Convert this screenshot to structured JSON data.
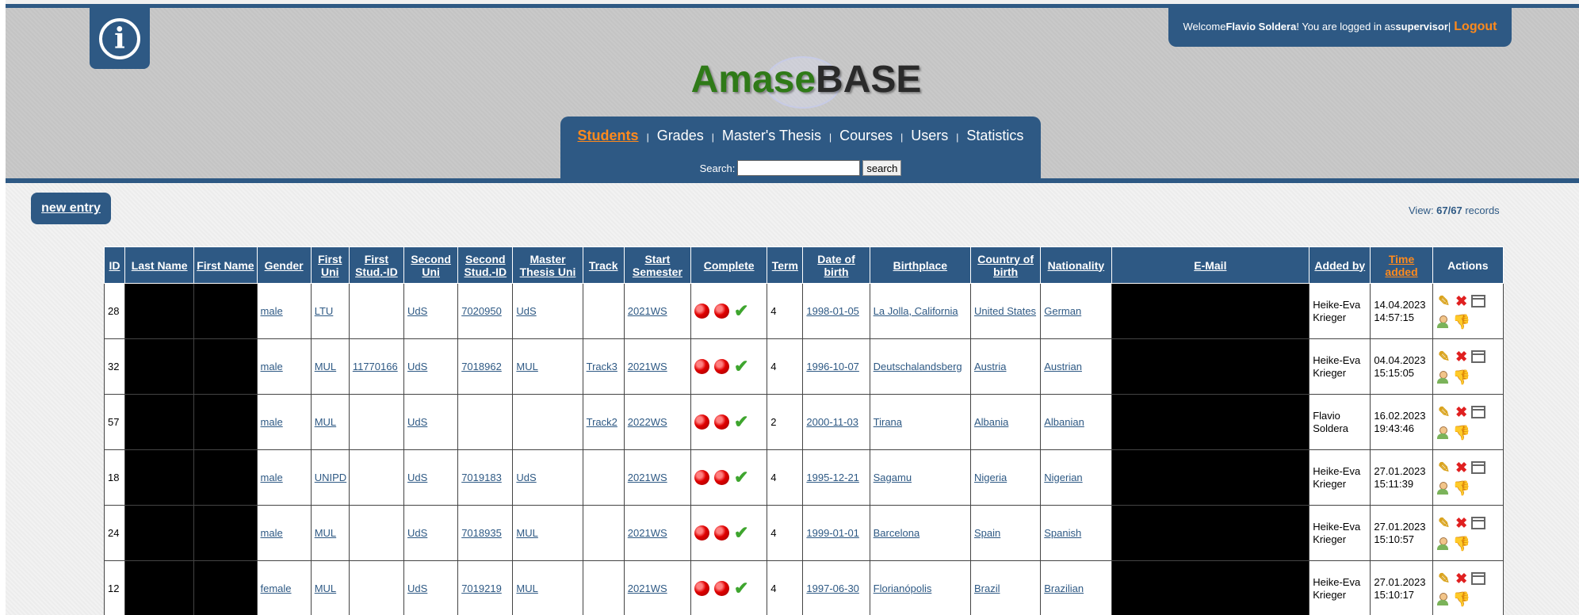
{
  "header": {
    "info_icon": "info-icon",
    "logo": {
      "part1": "Amase",
      "part2": "BASE"
    },
    "welcome": {
      "prefix": "Welcome ",
      "user_name": "Flavio Soldera",
      "middle": "! You are logged in as ",
      "role": "supervisor",
      "separator": " | ",
      "logout_label": "Logout"
    }
  },
  "nav": {
    "items": [
      {
        "label": "Students",
        "active": true
      },
      {
        "label": "Grades",
        "active": false
      },
      {
        "label": "Master's Thesis",
        "active": false
      },
      {
        "label": "Courses",
        "active": false
      },
      {
        "label": "Users",
        "active": false
      },
      {
        "label": "Statistics",
        "active": false
      }
    ],
    "separator": "|",
    "search_label": "Search:",
    "search_value": "",
    "search_button": "search"
  },
  "toolbar": {
    "new_entry_label": "new entry",
    "view_prefix": "View: ",
    "view_count": "67/67",
    "view_suffix": " records"
  },
  "colors": {
    "accent": "#2e5984",
    "active": "#ff8a1c",
    "status_red": "#e00000",
    "status_green": "#3ea52e"
  },
  "table": {
    "headers": [
      "ID",
      "Last Name",
      "First Name",
      "Gender",
      "First Uni",
      "First Stud.-ID",
      "Second Uni",
      "Second Stud.-ID",
      "Master Thesis Uni",
      "Track",
      "Start Semester",
      "Complete",
      "Term",
      "Date of birth",
      "Birthplace",
      "Country of birth",
      "Nationality",
      "E-Mail",
      "Added by",
      "Time added",
      "Actions"
    ],
    "rows": [
      {
        "id": "28",
        "gender": "male",
        "first_uni": "LTU",
        "first_stud_id": "",
        "second_uni": "UdS",
        "second_stud_id": "7020950",
        "thesis_uni": "UdS",
        "track": "",
        "start_semester": "2021WS",
        "term": "4",
        "dob": "1998-01-05",
        "birthplace": "La Jolla, California",
        "country": "United States",
        "nationality": "German",
        "added_by": "Heike-Eva Krieger",
        "time_added": "14.04.2023 14:57:15"
      },
      {
        "id": "32",
        "gender": "male",
        "first_uni": "MUL",
        "first_stud_id": "11770166",
        "second_uni": "UdS",
        "second_stud_id": "7018962",
        "thesis_uni": "MUL",
        "track": "Track3",
        "start_semester": "2021WS",
        "term": "4",
        "dob": "1996-10-07",
        "birthplace": "Deutschalandsberg",
        "country": "Austria",
        "nationality": "Austrian",
        "added_by": "Heike-Eva Krieger",
        "time_added": "04.04.2023 15:15:05"
      },
      {
        "id": "57",
        "gender": "male",
        "first_uni": "MUL",
        "first_stud_id": "",
        "second_uni": "UdS",
        "second_stud_id": "",
        "thesis_uni": "",
        "track": "Track2",
        "start_semester": "2022WS",
        "term": "2",
        "dob": "2000-11-03",
        "birthplace": "Tirana",
        "country": "Albania",
        "nationality": "Albanian",
        "added_by": "Flavio Soldera",
        "time_added": "16.02.2023 19:43:46"
      },
      {
        "id": "18",
        "gender": "male",
        "first_uni": "UNIPD",
        "first_stud_id": "",
        "second_uni": "UdS",
        "second_stud_id": "7019183",
        "thesis_uni": "UdS",
        "track": "",
        "start_semester": "2021WS",
        "term": "4",
        "dob": "1995-12-21",
        "birthplace": "Sagamu",
        "country": "Nigeria",
        "nationality": "Nigerian",
        "added_by": "Heike-Eva Krieger",
        "time_added": "27.01.2023 15:11:39"
      },
      {
        "id": "24",
        "gender": "male",
        "first_uni": "MUL",
        "first_stud_id": "",
        "second_uni": "UdS",
        "second_stud_id": "7018935",
        "thesis_uni": "MUL",
        "track": "",
        "start_semester": "2021WS",
        "term": "4",
        "dob": "1999-01-01",
        "birthplace": "Barcelona",
        "country": "Spain",
        "nationality": "Spanish",
        "added_by": "Heike-Eva Krieger",
        "time_added": "27.01.2023 15:10:57"
      },
      {
        "id": "12",
        "gender": "female",
        "first_uni": "MUL",
        "first_stud_id": "",
        "second_uni": "UdS",
        "second_stud_id": "7019219",
        "thesis_uni": "MUL",
        "track": "",
        "start_semester": "2021WS",
        "term": "4",
        "dob": "1997-06-30",
        "birthplace": "Florianópolis",
        "country": "Brazil",
        "nationality": "Brazilian",
        "added_by": "Heike-Eva Krieger",
        "time_added": "27.01.2023 15:10:17"
      }
    ],
    "complete_icons": [
      "red-dot-icon",
      "red-dot-icon",
      "green-check-icon"
    ],
    "action_icons": [
      "edit-icon",
      "delete-icon",
      "calendar-icon",
      "user-icon",
      "thumbs-down-icon"
    ]
  }
}
